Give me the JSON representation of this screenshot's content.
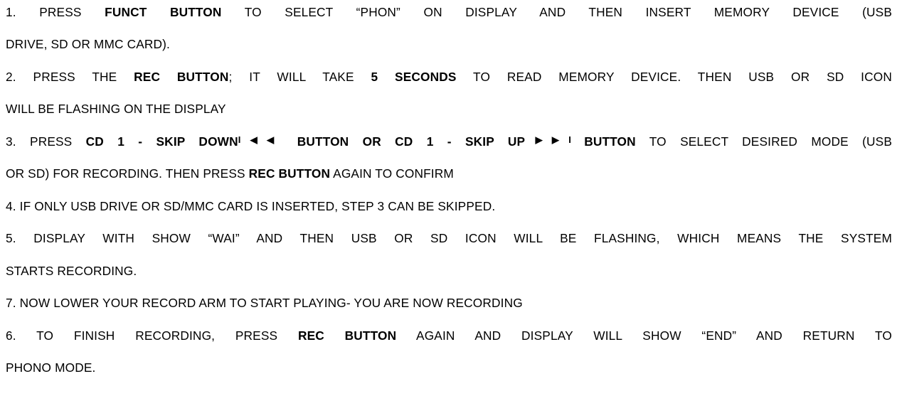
{
  "steps": [
    {
      "lines": [
        [
          {
            "t": "1. PRESS "
          },
          {
            "t": "FUNCT BUTTON",
            "b": true
          },
          {
            "t": " TO SELECT “PHON” ON DISPLAY AND THEN INSERT MEMORY DEVICE (USB"
          }
        ],
        [
          {
            "t": "DRIVE, SD OR MMC CARD)."
          }
        ]
      ]
    },
    {
      "lines": [
        [
          {
            "t": "2. PRESS THE "
          },
          {
            "t": "REC BUTTON",
            "b": true
          },
          {
            "t": "; IT WILL TAKE "
          },
          {
            "t": "5 SECONDS",
            "b": true
          },
          {
            "t": " TO READ MEMORY DEVICE. THEN USB OR SD ICON"
          }
        ],
        [
          {
            "t": "WILL BE FLASHING ON THE DISPLAY"
          }
        ]
      ]
    },
    {
      "lines": [
        [
          {
            "t": "3. PRESS "
          },
          {
            "t": "CD 1 - SKIP DOWN",
            "b": true
          },
          {
            "t": "I◀◀",
            "g": "skip-back-icon"
          },
          {
            "t": "  BUTTON OR CD 1 - SKIP UP",
            "b": true
          },
          {
            "t": "▶▶I",
            "g": "skip-forward-icon"
          },
          {
            "t": "  BUTTON",
            "b": true
          },
          {
            "t": " TO SELECT DESIRED MODE (USB"
          }
        ],
        [
          {
            "t": "OR SD) FOR RECORDING. THEN PRESS "
          },
          {
            "t": "REC BUTTON",
            "b": true
          },
          {
            "t": " AGAIN TO CONFIRM"
          }
        ]
      ]
    },
    {
      "lines": [
        [
          {
            "t": "4. IF ONLY USB DRIVE OR SD/MMC CARD IS INSERTED, STEP 3 CAN BE SKIPPED."
          }
        ]
      ]
    },
    {
      "lines": [
        [
          {
            "t": "5. DISPLAY WITH SHOW “WAI” AND THEN USB OR SD ICON WILL BE FLASHING, WHICH MEANS THE SYSTEM"
          }
        ],
        [
          {
            "t": "STARTS RECORDING."
          }
        ]
      ]
    },
    {
      "lines": [
        [
          {
            "t": "7. NOW LOWER YOUR RECORD ARM TO START PLAYING- YOU ARE NOW RECORDING"
          }
        ]
      ]
    },
    {
      "lines": [
        [
          {
            "t": "6. TO FINISH RECORDING, PRESS "
          },
          {
            "t": "REC BUTTON",
            "b": true
          },
          {
            "t": " AGAIN AND DISPLAY WILL SHOW “END” AND RETURN TO"
          }
        ],
        [
          {
            "t": "PHONO MODE."
          }
        ]
      ]
    }
  ]
}
